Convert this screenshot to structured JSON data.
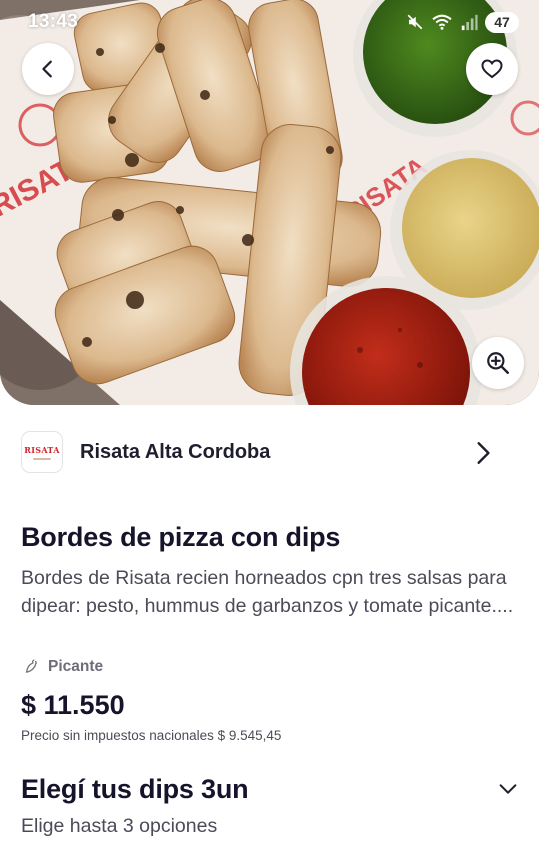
{
  "status_bar": {
    "time": "13:43",
    "battery": "47",
    "icons": [
      "mute-icon",
      "wifi-icon",
      "signal-icon",
      "battery-icon"
    ]
  },
  "hero": {
    "image_description_icon": "food-photo",
    "back_icon": "chevron-left-icon",
    "favorite_icon": "heart-icon",
    "zoom_icon": "zoom-in-icon"
  },
  "store": {
    "logo_text": "RISATA",
    "name": "Risata Alta Cordoba",
    "chevron_icon": "chevron-right-icon"
  },
  "product": {
    "title": "Bordes de pizza con dips",
    "description": "Bordes de Risata recien horneados cpn tres salsas para dipear: pesto, hummus de garbanzos y tomate picante....",
    "tag_icon": "chili-pepper-icon",
    "tag": "Picante",
    "price": "$ 11.550",
    "price_without_taxes": "Precio sin impuestos nacionales $ 9.545,45"
  },
  "options": {
    "title": "Elegí tus dips 3un",
    "subtitle": "Elige hasta 3 opciones",
    "chevron_icon": "chevron-down-icon"
  },
  "colors": {
    "brand_red": "#d2232a",
    "text_dark": "#16142a",
    "text_muted": "#4c4c58"
  }
}
